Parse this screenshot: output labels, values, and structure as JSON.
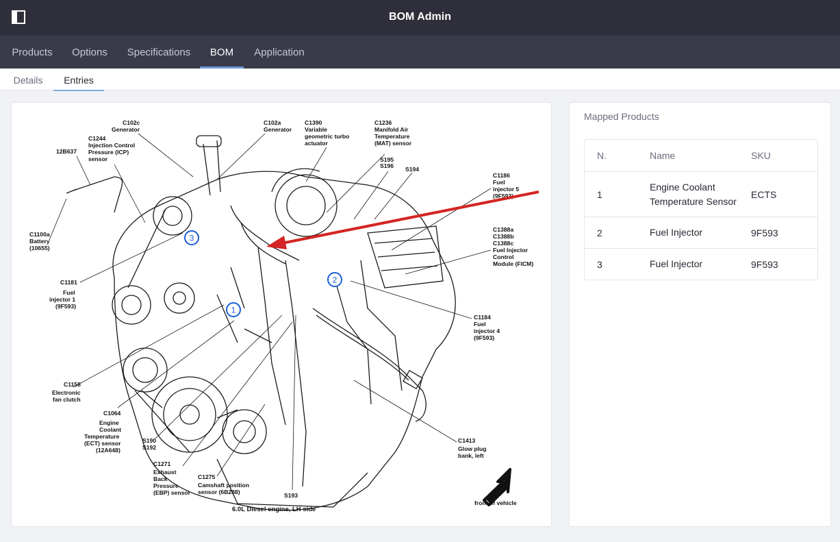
{
  "app": {
    "title": "BOM Admin"
  },
  "nav": {
    "tabs": [
      {
        "label": "Products"
      },
      {
        "label": "Options"
      },
      {
        "label": "Specifications"
      },
      {
        "label": "BOM"
      },
      {
        "label": "Application"
      }
    ]
  },
  "subnav": {
    "tabs": [
      {
        "label": "Details"
      },
      {
        "label": "Entries"
      }
    ]
  },
  "diagram": {
    "labels": {
      "c102c": [
        "C102c",
        "Generator"
      ],
      "c102a": [
        "C102a",
        "Generator"
      ],
      "c1390": [
        "C1390",
        "Variable",
        "geometric turbo",
        "actuator"
      ],
      "c1236": [
        "C1236",
        "Manifold Air",
        "Temperature",
        "(MAT) sensor"
      ],
      "c1244": [
        "C1244",
        "Injection Control",
        "Pressure (ICP)",
        "sensor"
      ],
      "b12637": [
        "12B637"
      ],
      "s195": [
        "S195",
        "S196"
      ],
      "s194": [
        "S194"
      ],
      "c1186": [
        "C1186",
        "Fuel",
        "injector 5",
        "(9F593)"
      ],
      "c1388": [
        "C1388a",
        "C1388b",
        "C1388c",
        "Fuel Injector",
        "Control",
        "Module (FICM)"
      ],
      "c1100a": [
        "C1100a",
        "Battery",
        "(10655)"
      ],
      "c1181": [
        "C1181",
        "Fuel",
        "injector 1",
        "(9F593)"
      ],
      "c1184": [
        "C1184",
        "Fuel",
        "injector 4",
        "(9F593)"
      ],
      "c1158": [
        "C1158",
        "Electronic",
        "fan clutch"
      ],
      "c1064": [
        "C1064",
        "Engine",
        "Coolant",
        "Temperature",
        "(ECT) sensor",
        "(12A648)"
      ],
      "s190": [
        "S190",
        "S192"
      ],
      "c1271": [
        "C1271",
        "Exhaust",
        "Back",
        "Pressure",
        "(EBP) sensor"
      ],
      "c1275": [
        "C1275",
        "Camshaft position",
        "sensor (6B288)"
      ],
      "s193": [
        "S193"
      ],
      "c1413": [
        "C1413",
        "Glow plug",
        "bank, left"
      ]
    },
    "caption": "6.0L Diesel engine, LH side",
    "front_label": "front of vehicle",
    "markers": [
      "1",
      "2",
      "3"
    ],
    "arrow_color": "#d42424",
    "marker_color": "#1a5ed8"
  },
  "products": {
    "title": "Mapped Products",
    "headers": {
      "n": "N.",
      "name": "Name",
      "sku": "SKU"
    },
    "rows": [
      {
        "n": "1",
        "name": "Engine Coolant Temperature Sensor",
        "sku": "ECTS"
      },
      {
        "n": "2",
        "name": "Fuel Injector",
        "sku": "9F593"
      },
      {
        "n": "3",
        "name": "Fuel Injector",
        "sku": "9F593"
      }
    ]
  }
}
